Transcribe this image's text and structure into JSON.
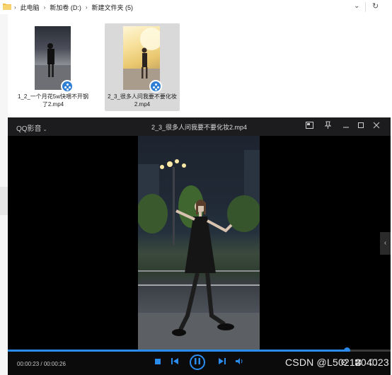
{
  "addressbar": {
    "crumbs": [
      "此电脑",
      "新加卷 (D:)",
      "新建文件夹 (5)"
    ],
    "separator": "›"
  },
  "files": [
    {
      "name": "1_2_一个月花5w快喂不开钢了2.mp4",
      "selected": false
    },
    {
      "name": "2_3_很多人问我要不要化妆2.mp4",
      "selected": true
    }
  ],
  "player": {
    "brand": "QQ影音",
    "title": "2_3_很多人问我要不要化妆2.mp4",
    "current_time": "00:00:23",
    "total_time": "00:00:26",
    "time_separator": " / ",
    "progress": 0.885,
    "accent": "#2b8cf0",
    "controls": [
      "stop-icon",
      "prev-icon",
      "pause-icon",
      "next-icon",
      "volume-icon"
    ],
    "window_buttons": [
      "miniplayer-icon",
      "pin-icon",
      "minimize-icon",
      "maximize-icon",
      "close-icon"
    ]
  },
  "watermark": "CSDN @L5021204023"
}
